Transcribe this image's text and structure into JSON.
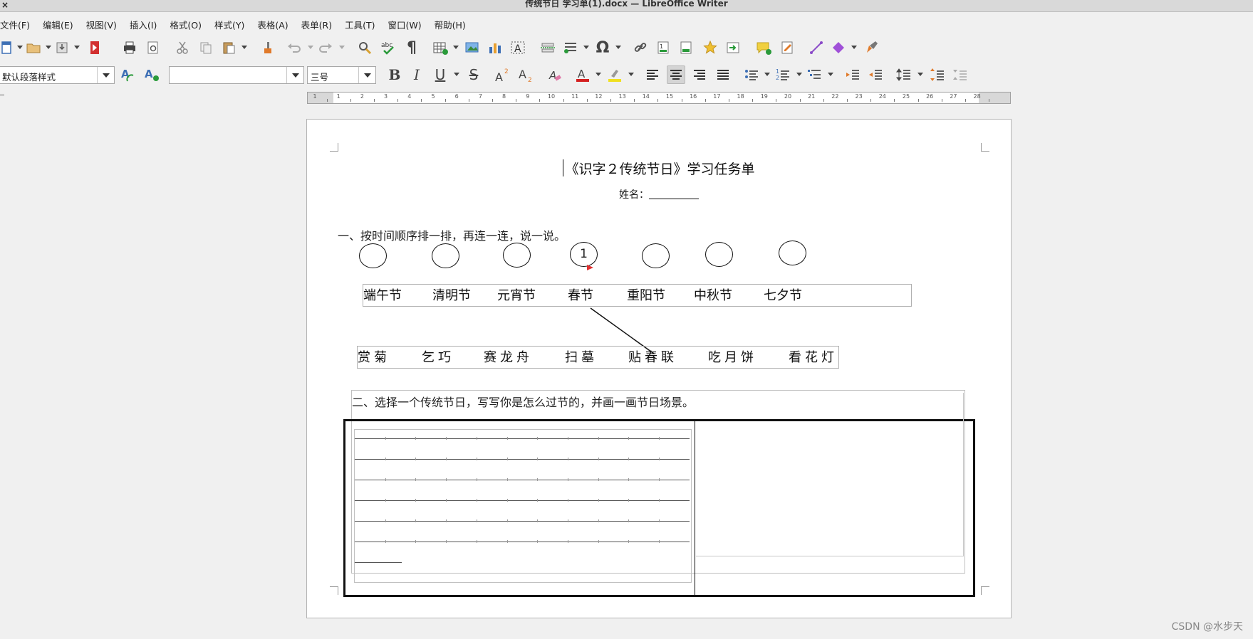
{
  "window": {
    "title": "传统节日 学习单(1).docx — LibreOffice Writer",
    "close_glyph": "×"
  },
  "menu": [
    {
      "label": "文件(F)"
    },
    {
      "label": "编辑(E)"
    },
    {
      "label": "视图(V)"
    },
    {
      "label": "插入(I)"
    },
    {
      "label": "格式(O)"
    },
    {
      "label": "样式(Y)"
    },
    {
      "label": "表格(A)"
    },
    {
      "label": "表单(R)"
    },
    {
      "label": "工具(T)"
    },
    {
      "label": "窗口(W)"
    },
    {
      "label": "帮助(H)"
    }
  ],
  "format_bar": {
    "paragraph_style": "默认段落样式",
    "font_name": "",
    "font_size": "三号"
  },
  "ruler": {
    "labels": [
      "1",
      "1",
      "2",
      "3",
      "4",
      "5",
      "6",
      "7",
      "8",
      "9",
      "10",
      "11",
      "12",
      "13",
      "14",
      "15",
      "16",
      "17",
      "18",
      "19",
      "20",
      "21",
      "22",
      "23",
      "24",
      "25",
      "26",
      "27",
      "28"
    ]
  },
  "document": {
    "title": "《识字２传统节日》学习任务单",
    "name_label": "姓名：",
    "question1": "一、按时间顺序排一排，再连一连，说一说。",
    "circles": [
      "",
      "",
      "",
      "1",
      "",
      "",
      ""
    ],
    "festivals": [
      "端午节",
      "清明节",
      "元宵节",
      "春节",
      "重阳节",
      "中秋节",
      "七夕节"
    ],
    "customs": [
      "赏菊",
      "乞巧",
      "赛龙舟",
      "扫墓",
      "贴春联",
      "吃月饼",
      "看花灯"
    ],
    "question2": "二、选择一个传统节日，写写你是怎么过节的，并画一画节日场景。",
    "writing_lines": 7
  },
  "watermark": "CSDN @水步天"
}
